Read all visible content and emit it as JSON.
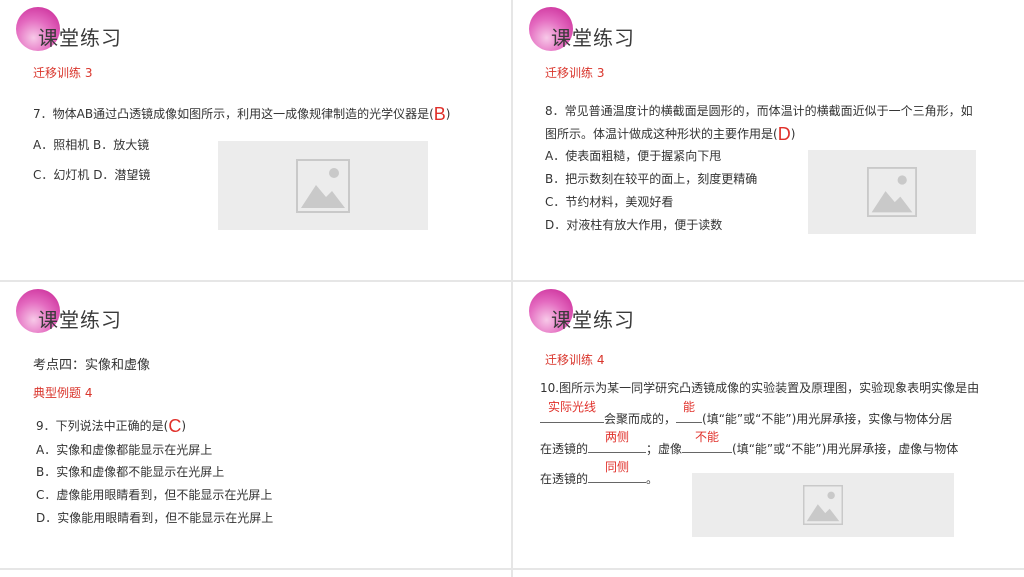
{
  "heading": "课堂练习",
  "s1": {
    "sub": "迁移训练 3",
    "q": "7．物体AB通过凸透镜成像如图所示，利用这一成像规律制造的光学仪器是(",
    "ans": "B",
    "close": ")",
    "opt1": "A．照相机  B．放大镜",
    "opt2": "C．幻灯机  D．潜望镜"
  },
  "s2": {
    "sub": "迁移训练 3",
    "q1": "8．常见普通温度计的横截面是圆形的，而体温计的横截面近似于一个三角形，如",
    "q2": "图所示。体温计做成这种形状的主要作用是(",
    "ans": "D",
    "close": ")",
    "a": "A．使表面粗糙，便于握紧向下甩",
    "b": "B．把示数刻在较平的面上，刻度更精确",
    "c": "C．节约材料，美观好看",
    "d": "D．对液柱有放大作用，便于读数"
  },
  "s3": {
    "topic": "考点四：实像和虚像",
    "sub": "典型例题 4",
    "q": "9．下列说法中正确的是(",
    "ans": "C",
    "close": ")",
    "a": "A．实像和虚像都能显示在光屏上",
    "b": "B．实像和虚像都不能显示在光屏上",
    "c": "C．虚像能用眼睛看到，但不能显示在光屏上",
    "d": "D．实像能用眼睛看到，但不能显示在光屏上"
  },
  "s4": {
    "sub": "迁移训练 4",
    "l1": "10.图所示为某一同学研究凸透镜成像的实验装置及原理图，实验现象表明实像是由",
    "b1": "实际光线",
    "l2a": "会聚而成的，",
    "b2": "能",
    "l2b": "(填“能”或“不能”)用光屏承接，实像与物体分居",
    "l3a": "在透镜的",
    "b3": "两侧",
    "l3b": "；虚像",
    "b4": "不能",
    "l3c": "(填“能”或“不能”)用光屏承接，虚像与物体",
    "l4a": "在透镜的",
    "b5": "同侧",
    "l4b": "。"
  },
  "colors": {
    "red": "#d9352c",
    "accent": "#c51d90",
    "placeholder": "#ececec"
  },
  "icons": [
    "image-placeholder-icon"
  ]
}
